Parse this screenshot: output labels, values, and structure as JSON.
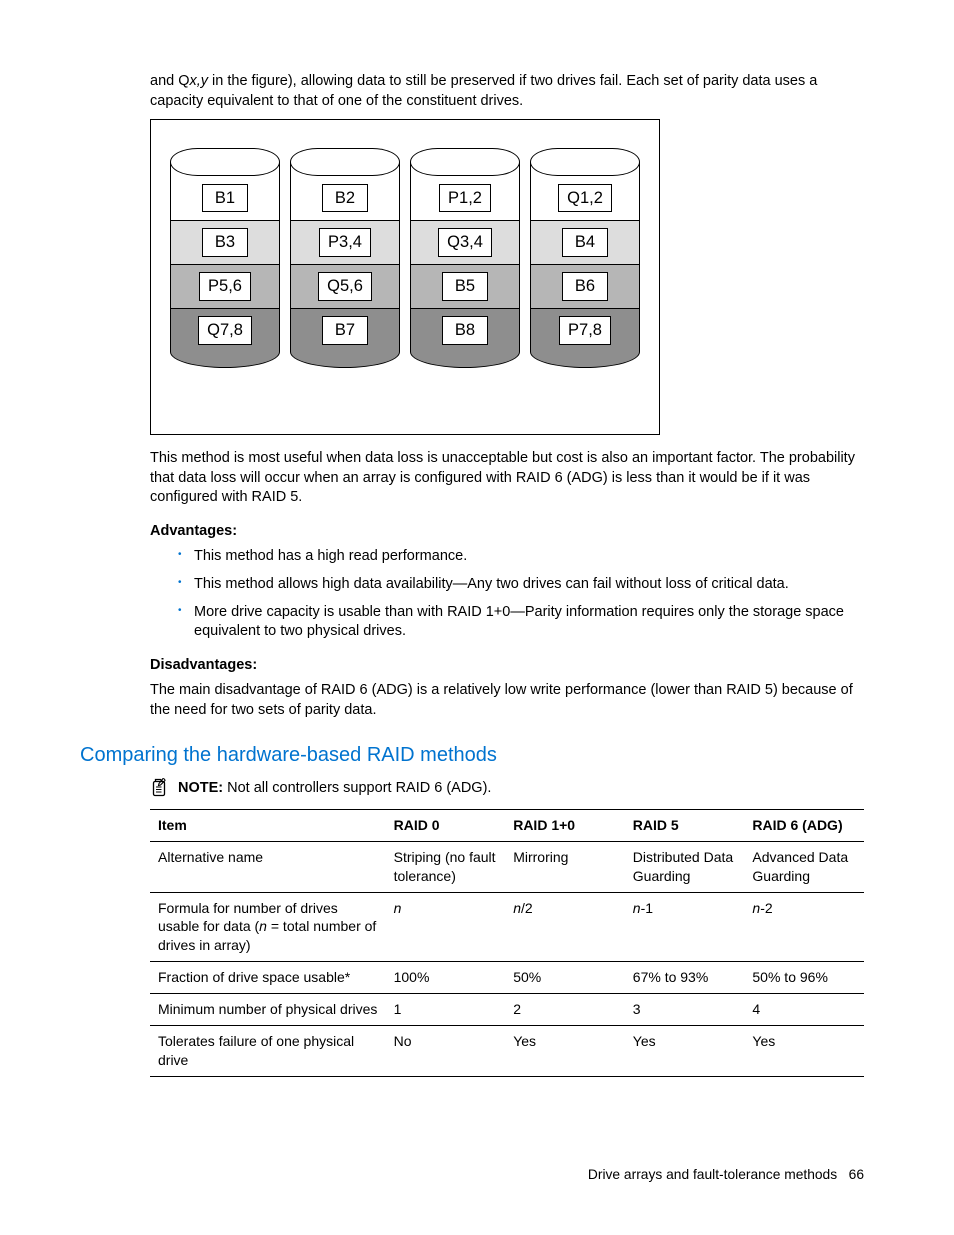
{
  "intro_before_italic": "and Q",
  "intro_italic": "x,y",
  "intro_after_italic": " in the figure), allowing data to still be preserved if two drives fail. Each set of parity data uses a capacity equivalent to that of one of the constituent drives.",
  "diagram": {
    "cylinders": [
      {
        "slices": [
          {
            "label": "B1",
            "shade": 0
          },
          {
            "label": "B3",
            "shade": 1
          },
          {
            "label": "P5,6",
            "shade": 2
          },
          {
            "label": "Q7,8",
            "shade": 3
          }
        ]
      },
      {
        "slices": [
          {
            "label": "B2",
            "shade": 0
          },
          {
            "label": "P3,4",
            "shade": 1
          },
          {
            "label": "Q5,6",
            "shade": 2
          },
          {
            "label": "B7",
            "shade": 3
          }
        ]
      },
      {
        "slices": [
          {
            "label": "P1,2",
            "shade": 0
          },
          {
            "label": "Q3,4",
            "shade": 1
          },
          {
            "label": "B5",
            "shade": 2
          },
          {
            "label": "B8",
            "shade": 3
          }
        ]
      },
      {
        "slices": [
          {
            "label": "Q1,2",
            "shade": 0
          },
          {
            "label": "B4",
            "shade": 1
          },
          {
            "label": "B6",
            "shade": 2
          },
          {
            "label": "P7,8",
            "shade": 3
          }
        ]
      }
    ]
  },
  "after_diagram": "This method is most useful when data loss is unacceptable but cost is also an important factor. The probability that data loss will occur when an array is configured with RAID 6 (ADG) is less than it would be if it was configured with RAID 5.",
  "advantages_heading": "Advantages:",
  "advantages": [
    "This method has a high read performance.",
    "This method allows high data availability—Any two drives can fail without loss of critical data.",
    "More drive capacity is usable than with RAID 1+0—Parity information requires only the storage space equivalent to two physical drives."
  ],
  "disadvantages_heading": "Disadvantages:",
  "disadvantages_text": "The main disadvantage of RAID 6 (ADG) is a relatively low write performance (lower than RAID 5) because of the need for two sets of parity data.",
  "section_heading": "Comparing the hardware-based RAID methods",
  "note_label": "NOTE:",
  "note_text": "Not all controllers support RAID 6 (ADG).",
  "table": {
    "headers": [
      "Item",
      "RAID 0",
      "RAID 1+0",
      "RAID 5",
      "RAID 6 (ADG)"
    ],
    "rows": [
      {
        "item_plain": "Alternative name",
        "values_plain": [
          "Striping (no fault tolerance)",
          "Mirroring",
          "Distributed Data Guarding",
          "Advanced Data Guarding"
        ]
      },
      {
        "item_formula_a": "Formula for number of drives usable for data (",
        "item_formula_n": "n",
        "item_formula_b": " = total number of drives in array)",
        "values_formula": [
          {
            "pre": "",
            "n": "n",
            "post": ""
          },
          {
            "pre": "",
            "n": "n",
            "post": "/2"
          },
          {
            "pre": "",
            "n": "n",
            "post": "-1"
          },
          {
            "pre": "",
            "n": "n",
            "post": "-2"
          }
        ]
      },
      {
        "item_plain": "Fraction of drive space usable*",
        "values_plain": [
          "100%",
          "50%",
          "67% to 93%",
          "50% to 96%"
        ]
      },
      {
        "item_plain": "Minimum number of physical drives",
        "values_plain": [
          "1",
          "2",
          "3",
          "4"
        ]
      },
      {
        "item_plain": "Tolerates failure of one physical drive",
        "values_plain": [
          "No",
          "Yes",
          "Yes",
          "Yes"
        ]
      }
    ]
  },
  "footer_text": "Drive arrays and fault-tolerance methods",
  "footer_page": "66"
}
